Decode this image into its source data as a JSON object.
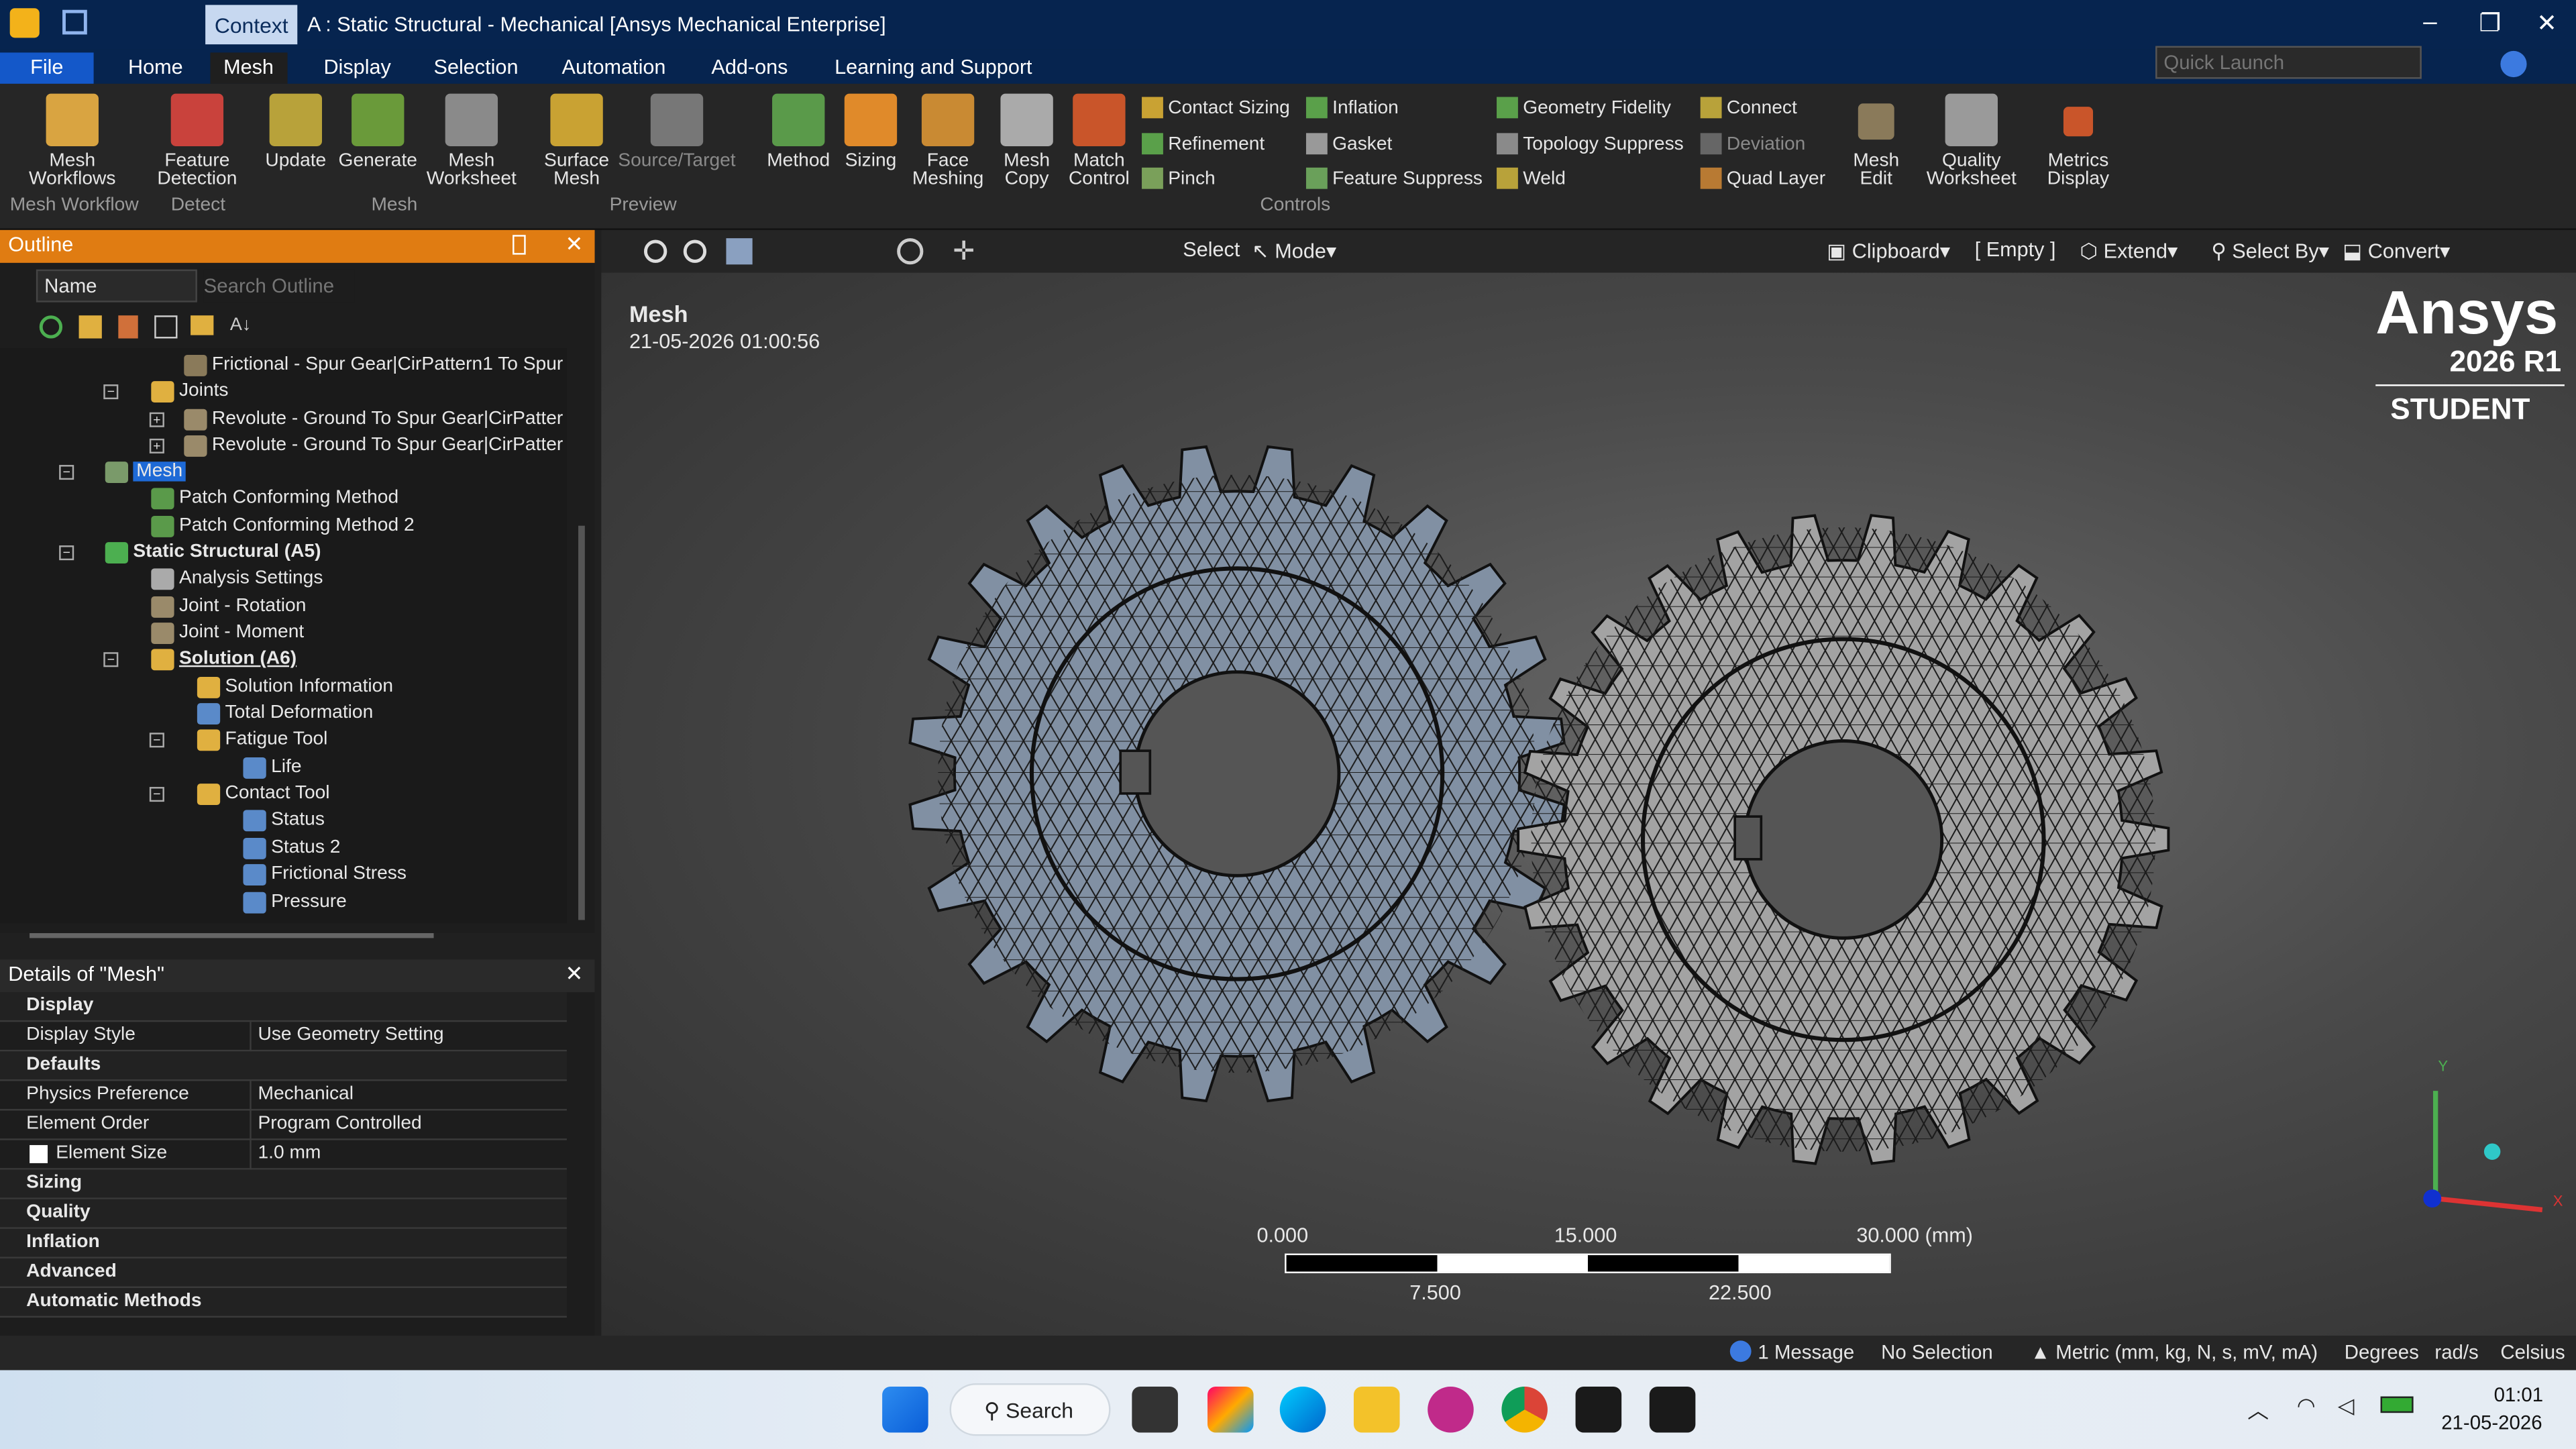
{
  "window": {
    "context_tab": "Context",
    "title": "A : Static Structural - Mechanical [Ansys Mechanical Enterprise]"
  },
  "tabs": [
    "File",
    "Home",
    "Mesh",
    "Display",
    "Selection",
    "Automation",
    "Add-ons",
    "Learning and Support"
  ],
  "quick_launch": {
    "placeholder": "Quick Launch"
  },
  "ribbon": {
    "mesh_workflow": {
      "label": "Mesh Workflows",
      "group": "Mesh Workflow"
    },
    "detect": {
      "label": "Feature Detection",
      "group": "Detect"
    },
    "mesh": {
      "update": "Update",
      "generate": "Generate",
      "worksheet": "Mesh Worksheet",
      "group": "Mesh"
    },
    "preview": {
      "surface": "Surface Mesh",
      "source": "Source/Target",
      "group": "Preview"
    },
    "controls": {
      "method": "Method",
      "sizing": "Sizing",
      "face": "Face Meshing",
      "copy": "Mesh Copy",
      "match": "Match Control",
      "contact_sizing": "Contact Sizing",
      "refinement": "Refinement",
      "pinch": "Pinch",
      "inflation": "Inflation",
      "gasket": "Gasket",
      "geometry_fidelity": "Geometry Fidelity",
      "topology_suppress": "Topology Suppress",
      "feature_suppress": "Feature Suppress",
      "weld": "Weld",
      "connect": "Connect",
      "deviation": "Deviation",
      "quad_layer": "Quad Layer",
      "group": "Controls"
    },
    "mesh_edit": "Mesh Edit",
    "quality": "Quality Worksheet",
    "metrics": "Metrics Display"
  },
  "outline": {
    "title": "Outline",
    "filter": "Name",
    "search": "Search Outline",
    "nodes": [
      "Frictional - Spur Gear|CirPattern1 To Spur",
      "Joints",
      "Revolute - Ground To Spur Gear|CirPatter",
      "Revolute - Ground To Spur Gear|CirPatter",
      "Mesh",
      "Patch Conforming Method",
      "Patch Conforming Method 2",
      "Static Structural (A5)",
      "Analysis Settings",
      "Joint - Rotation",
      "Joint - Moment",
      "Solution (A6)",
      "Solution Information",
      "Total Deformation",
      "Fatigue Tool",
      "Life",
      "Contact Tool",
      "Status",
      "Status 2",
      "Frictional Stress",
      "Pressure"
    ]
  },
  "details": {
    "title": "Details of \"Mesh\"",
    "rows": [
      [
        "Display",
        ""
      ],
      [
        "Display Style",
        "Use Geometry Setting"
      ],
      [
        "Defaults",
        ""
      ],
      [
        "Physics Preference",
        "Mechanical"
      ],
      [
        "Element Order",
        "Program Controlled"
      ],
      [
        "Element Size",
        "1.0 mm"
      ],
      [
        "Sizing",
        ""
      ],
      [
        "Quality",
        ""
      ],
      [
        "Inflation",
        ""
      ],
      [
        "Advanced",
        ""
      ],
      [
        "Automatic Methods",
        ""
      ]
    ]
  },
  "toolbar": {
    "select": "Select",
    "mode": "Mode",
    "clipboard": "Clipboard",
    "empty": "[ Empty ]",
    "extend": "Extend",
    "select_by": "Select By",
    "convert": "Convert"
  },
  "viewport": {
    "title": "Mesh",
    "timestamp": "21-05-2026 01:00:56",
    "brand": "Ansys",
    "version": "2026 R1",
    "edition": "STUDENT",
    "scale": {
      "t0": "0.000",
      "t1": "15.000",
      "t2": "30.000 (mm)",
      "b1": "7.500",
      "b2": "22.500"
    },
    "axis_y": "Y",
    "axis_x": "X"
  },
  "status": {
    "message": "1 Message",
    "selection": "No Selection",
    "units": "Metric (mm, kg, N, s, mV, mA)",
    "angle": "Degrees",
    "rate": "rad/s",
    "temp": "Celsius"
  },
  "taskbar": {
    "search": "Search",
    "time": "01:01",
    "date": "21-05-2026"
  }
}
